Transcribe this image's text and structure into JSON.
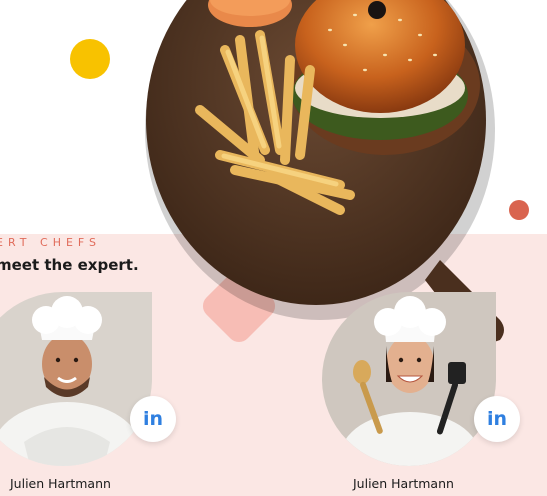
{
  "team": {
    "eyebrow": "ERT CHEFS",
    "headline": "meet the expert."
  },
  "chefs": [
    {
      "name": "Julien Hartmann",
      "social_label": "in"
    },
    {
      "name": "Julien Hartmann",
      "social_label": "in"
    }
  ],
  "colors": {
    "section_background": "#fbe7e4",
    "eyebrow": "#e06b5a",
    "yellow_dot": "#f8c200",
    "red_dot": "#d9644f",
    "linkedin": "#2f7fe0"
  },
  "icons": [
    "burger-plate-image",
    "linkedin-icon"
  ]
}
